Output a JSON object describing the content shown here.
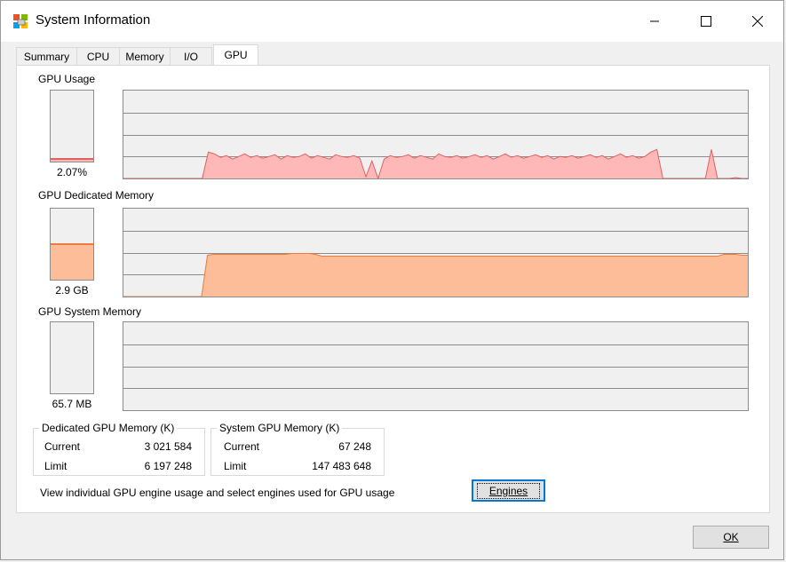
{
  "window": {
    "title": "System Information",
    "icon": "system-information-icon",
    "controls": [
      "minimize-icon",
      "maximize-icon",
      "close-icon"
    ]
  },
  "tabs": [
    {
      "label": "Summary",
      "active": false
    },
    {
      "label": "CPU",
      "active": false
    },
    {
      "label": "Memory",
      "active": false
    },
    {
      "label": "I/O",
      "active": false
    },
    {
      "label": "GPU",
      "active": true
    }
  ],
  "gpu_usage": {
    "label": "GPU Usage",
    "value_text": "2.07%",
    "fill_fraction": 0.0207,
    "color_fill": "#ffb8b8",
    "color_line": "#e06060"
  },
  "gpu_dedicated": {
    "label": "GPU Dedicated Memory",
    "value_text": "2.9 GB",
    "fill_fraction": 0.49,
    "color_fill": "#fcbd98",
    "color_line": "#ee7a3e"
  },
  "gpu_system": {
    "label": "GPU System Memory",
    "value_text": "65.7 MB",
    "fill_fraction": 0.0
  },
  "dedicated_group": {
    "title": "Dedicated GPU Memory (K)",
    "rows": [
      {
        "label": "Current",
        "value": "3 021 584"
      },
      {
        "label": "Limit",
        "value": "6 197 248"
      }
    ]
  },
  "system_group": {
    "title": "System GPU Memory (K)",
    "rows": [
      {
        "label": "Current",
        "value": "67 248"
      },
      {
        "label": "Limit",
        "value": "147 483 648"
      }
    ]
  },
  "footer": {
    "info_text": "View individual GPU engine usage and select engines used for GPU usage",
    "engines_label": "Engines",
    "ok_label": "OK"
  },
  "chart_data": [
    {
      "type": "area",
      "series": [
        {
          "values": [
            0,
            0,
            0,
            0,
            0,
            0,
            0,
            0,
            0,
            0,
            0,
            0,
            0,
            0,
            30,
            28,
            24,
            26,
            22,
            25,
            28,
            24,
            26,
            23,
            25,
            27,
            22,
            26,
            24,
            25,
            28,
            23,
            26,
            24,
            22,
            27,
            25,
            24,
            26,
            23,
            2,
            20,
            0,
            22,
            26,
            24,
            25,
            27,
            23,
            26,
            24,
            22,
            28,
            25,
            24,
            26,
            23,
            25,
            27,
            24,
            26,
            22,
            25,
            28,
            24,
            26,
            23,
            25,
            27,
            24,
            26,
            22,
            25,
            24,
            26,
            23,
            25,
            27,
            24,
            26,
            22,
            25,
            28,
            24,
            26,
            23,
            25,
            30,
            33,
            0,
            0,
            0,
            0,
            0,
            0,
            0,
            0,
            33,
            0,
            0,
            0,
            1,
            0,
            0
          ]
        }
      ],
      "ylim": [
        0,
        100
      ]
    },
    {
      "type": "area",
      "series": [
        {
          "values": [
            0,
            0,
            0,
            0,
            0,
            0,
            0,
            0,
            0,
            0,
            0,
            0,
            0,
            0,
            47,
            48,
            48,
            48,
            48,
            48,
            48,
            48,
            48,
            48,
            48,
            48,
            48,
            48,
            49,
            49,
            49,
            49,
            48,
            46,
            46,
            46,
            46,
            46,
            46,
            46,
            46,
            46,
            46,
            46,
            46,
            46,
            46,
            46,
            46,
            46,
            46,
            46,
            46,
            46,
            46,
            46,
            46,
            46,
            46,
            46,
            46,
            46,
            46,
            46,
            46,
            46,
            46,
            46,
            46,
            46,
            46,
            46,
            46,
            46,
            46,
            46,
            46,
            46,
            46,
            46,
            46,
            46,
            46,
            46,
            46,
            46,
            46,
            46,
            46,
            46,
            46,
            46,
            46,
            46,
            46,
            46,
            46,
            46,
            46,
            46,
            48,
            48,
            48,
            47,
            47
          ]
        }
      ],
      "ylim": [
        0,
        100
      ]
    },
    {
      "type": "area",
      "series": [
        {
          "values": [
            0,
            0,
            0,
            0,
            0,
            0,
            0,
            0,
            0,
            0
          ]
        }
      ],
      "ylim": [
        0,
        100
      ]
    }
  ]
}
